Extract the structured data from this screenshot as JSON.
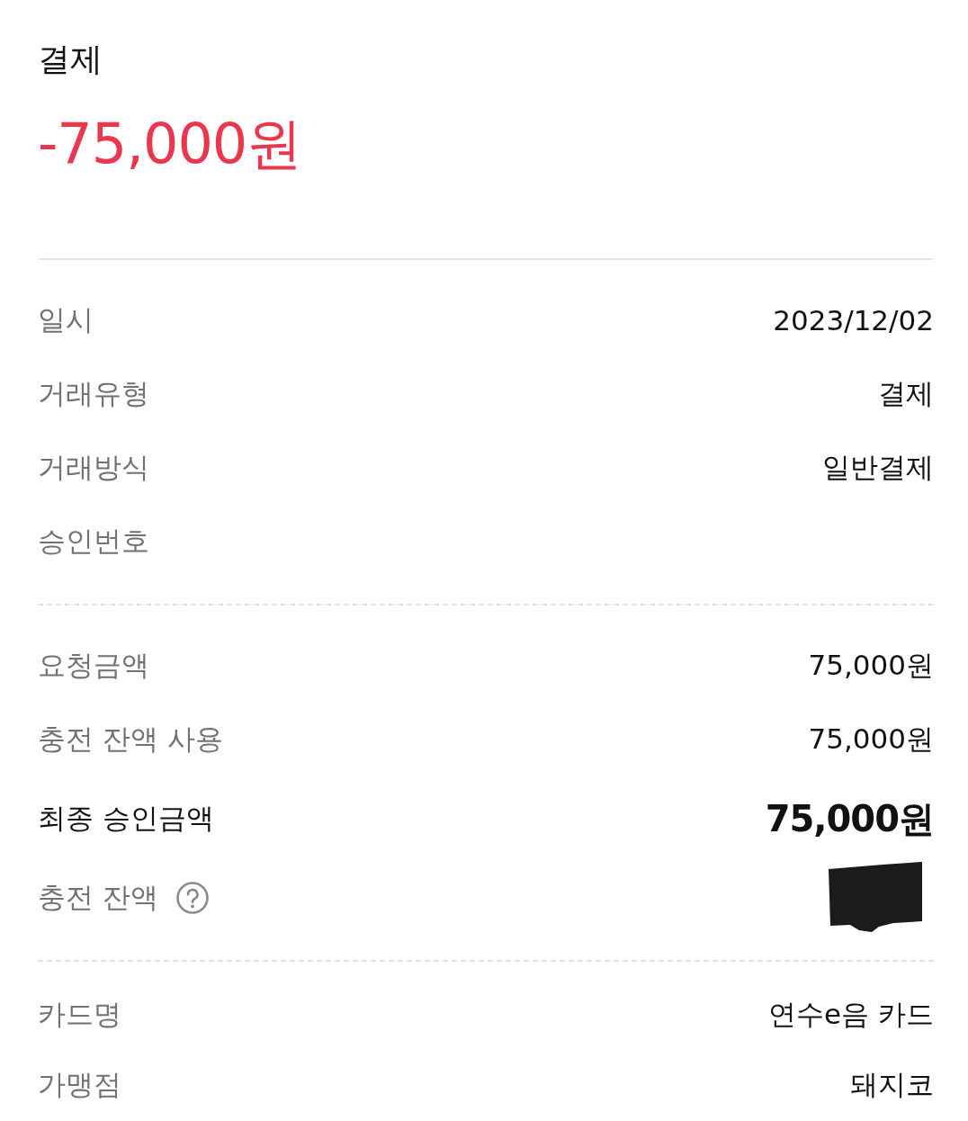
{
  "header": {
    "title": "결제",
    "amount": "-75,000원"
  },
  "sections": [
    {
      "rows": [
        {
          "label": "일시",
          "value": "2023/12/02",
          "kind": "plain",
          "help": false,
          "redacted": false
        },
        {
          "label": "거래유형",
          "value": "결제",
          "kind": "plain",
          "help": false,
          "redacted": false
        },
        {
          "label": "거래방식",
          "value": "일반결제",
          "kind": "plain",
          "help": false,
          "redacted": false
        },
        {
          "label": "승인번호",
          "kind": "plain",
          "help": false,
          "redacted": false
        }
      ]
    },
    {
      "rows": [
        {
          "label": "요청금액",
          "value": "75,000원",
          "kind": "plain",
          "help": false,
          "redacted": false
        },
        {
          "label": "충전 잔액 사용",
          "value": "75,000원",
          "kind": "plain",
          "help": false,
          "redacted": false
        },
        {
          "label": "최종 승인금액",
          "value": "75,000원",
          "kind": "total",
          "help": false,
          "redacted": false
        },
        {
          "label": "충전 잔액",
          "kind": "plain",
          "help": true,
          "redacted": true
        }
      ]
    },
    {
      "rows": [
        {
          "label": "카드명",
          "value": "연수e음 카드",
          "kind": "plain",
          "help": false,
          "redacted": false
        },
        {
          "label": "가맹점",
          "value": "돼지코",
          "kind": "plain",
          "help": false,
          "redacted": false
        }
      ]
    }
  ]
}
